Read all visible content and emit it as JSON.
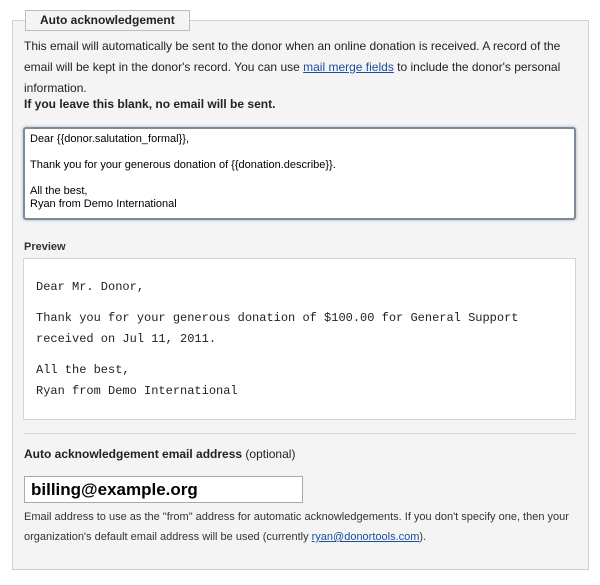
{
  "section": {
    "legend": "Auto acknowledgement",
    "intro_part1": "This email will automatically be sent to the donor when an online donation is received. A record of the email will be kept in the donor's record. You can use ",
    "merge_fields_link": "mail merge fields",
    "intro_part2": " to include the donor's personal information.",
    "warning": "If you leave this blank, no email will be sent."
  },
  "editor": {
    "line1": "Dear {{donor.salutation_formal}},",
    "line2": "Thank you for your generous donation of {{donation.describe}}.",
    "line3": "All the best,",
    "line4": "Ryan from Demo International"
  },
  "preview": {
    "label": "Preview",
    "line1": "Dear Mr. Donor,",
    "line2": "Thank you for your generous donation of $100.00 for General Support received on Jul 11, 2011.",
    "line3": "All the best,",
    "line4": "Ryan from Demo International"
  },
  "email_address": {
    "label": "Auto acknowledgement email address",
    "optional": "(optional)",
    "value": "billing@example.org",
    "hint_part1": "Email address to use as the \"from\" address for automatic acknowledgements. If you don't specify one, then your organization's default email address will be used (currently ",
    "default_email_link": "ryan@donortools.com",
    "hint_part2": ")."
  }
}
